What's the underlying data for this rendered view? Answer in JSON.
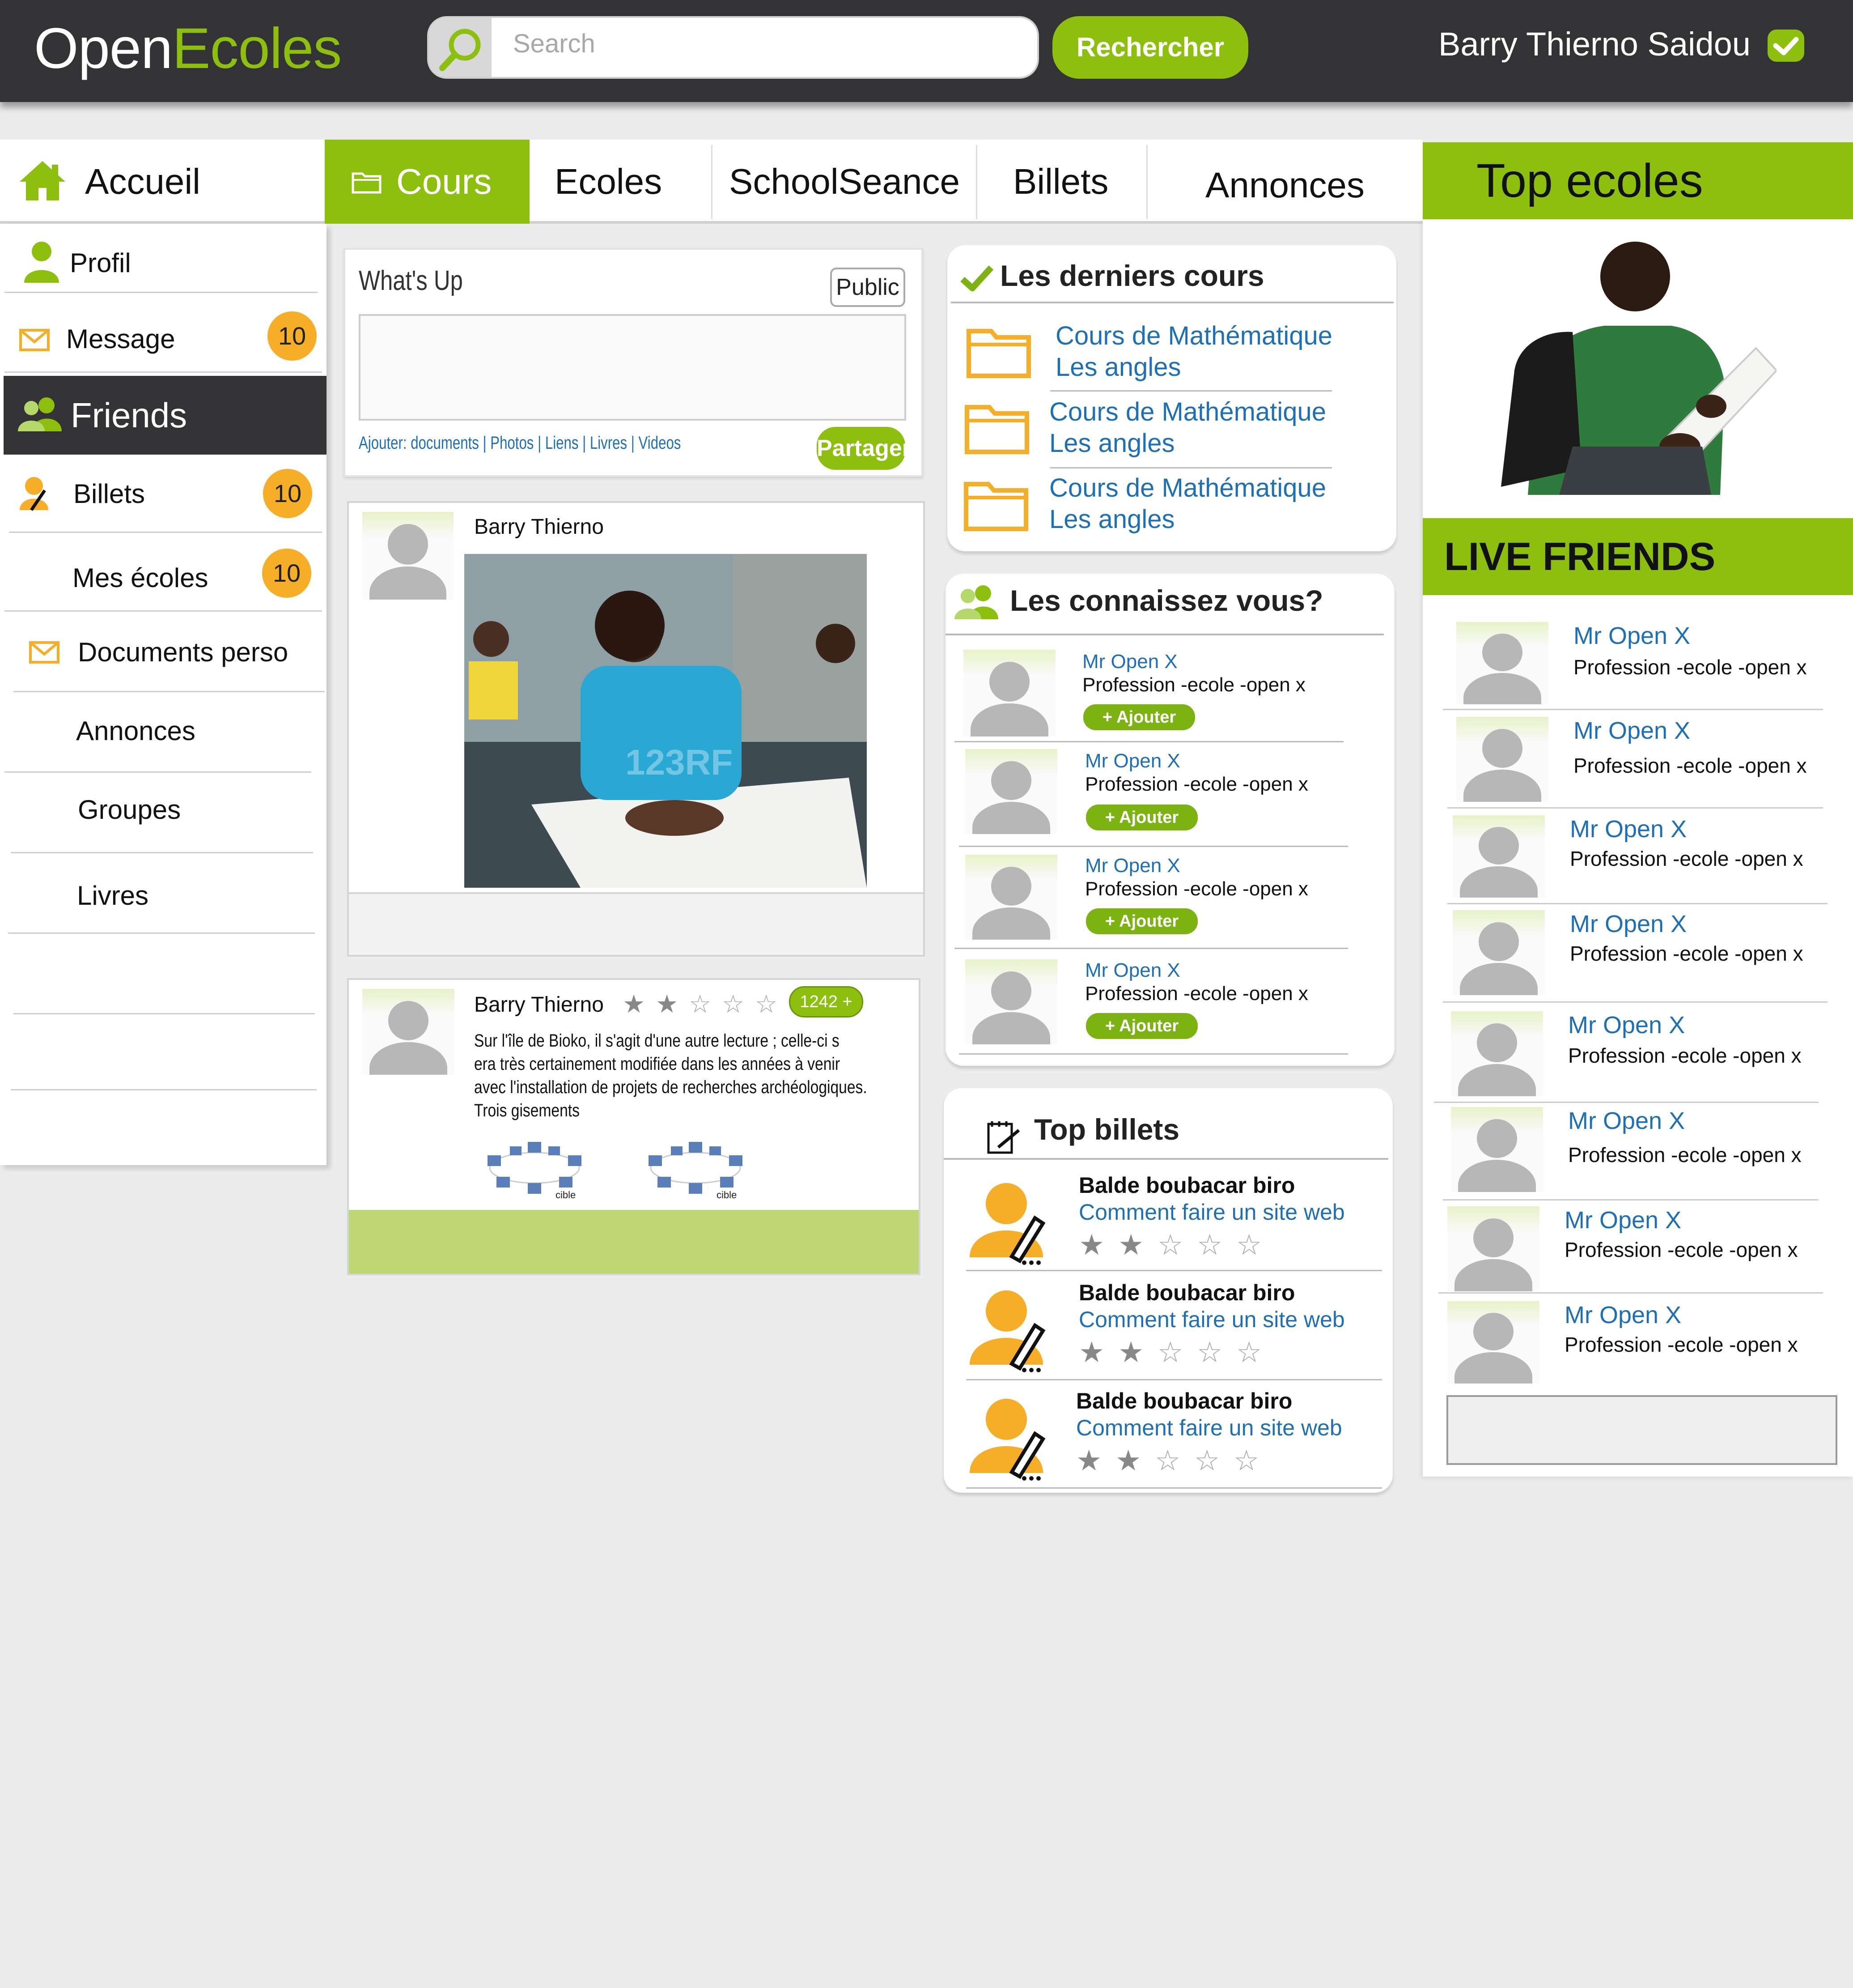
{
  "header": {
    "logo_open": "Open",
    "logo_ecoles": "Ecoles",
    "search_placeholder": "Search",
    "search_button": "Rechercher",
    "username": "Barry Thierno Saidou"
  },
  "nav": {
    "home": "Accueil",
    "cours": "Cours",
    "ecoles": "Ecoles",
    "schoolseance": "SchoolSeance",
    "billets": "Billets",
    "annonces": "Annonces"
  },
  "sidebar": {
    "items": [
      {
        "label": "Profil"
      },
      {
        "label": "Message",
        "badge": "10"
      },
      {
        "label": "Friends"
      },
      {
        "label": "Billets",
        "badge": "10"
      },
      {
        "label": "Mes écoles",
        "badge": "10"
      },
      {
        "label": "Documents perso"
      },
      {
        "label": "Annonces"
      },
      {
        "label": "Groupes"
      },
      {
        "label": "Livres"
      }
    ]
  },
  "whatsup": {
    "title": "What's Up",
    "visibility": "Public",
    "attach_prefix": "Ajouter: ",
    "attach_links": [
      "documents",
      "Photos",
      "Liens",
      "Livres",
      "Videos"
    ],
    "share_button": "Partager"
  },
  "posts": [
    {
      "author": "Barry Thierno",
      "photo_watermark": "123RF"
    },
    {
      "author": "Barry Thierno",
      "rating": 2,
      "count": "1242 +",
      "text_lines": [
        "Sur l'île de Bioko, il s'agit d'une autre lecture ; celle-ci s",
        "era très certainement modifiée dans les années à venir",
        "avec l'installation de projets de recherches archéologiques.",
        "Trois gisements"
      ],
      "thumb_caption": "cible"
    }
  ],
  "derniers_cours": {
    "title": "Les derniers cours",
    "items": [
      {
        "line1": "Cours de Mathématique",
        "line2": "Les angles"
      },
      {
        "line1": "Cours de Mathématique",
        "line2": "Les angles"
      },
      {
        "line1": "Cours de Mathématique",
        "line2": "Les angles"
      }
    ]
  },
  "connaissez": {
    "title": "Les connaissez vous?",
    "add_label": "+ Ajouter",
    "people": [
      {
        "name": "Mr Open X",
        "profession": "Profession -ecole -open x"
      },
      {
        "name": "Mr Open X",
        "profession": "Profession -ecole -open x"
      },
      {
        "name": "Mr Open X",
        "profession": "Profession -ecole -open x"
      },
      {
        "name": "Mr Open X",
        "profession": "Profession -ecole -open x"
      }
    ]
  },
  "top_billets": {
    "title": "Top billets",
    "items": [
      {
        "author": "Balde boubacar biro",
        "title": "Comment faire un site web",
        "rating": 2
      },
      {
        "author": "Balde boubacar biro",
        "title": "Comment faire un site web",
        "rating": 2
      },
      {
        "author": "Balde boubacar biro",
        "title": "Comment faire un site web",
        "rating": 2
      }
    ]
  },
  "right": {
    "top_ecoles_title": "Top ecoles",
    "live_friends_title": "LIVE FRIENDS",
    "friends": [
      {
        "name": "Mr Open X",
        "profession": "Profession -ecole -open x"
      },
      {
        "name": "Mr Open X",
        "profession": "Profession -ecole -open x"
      },
      {
        "name": "Mr Open X",
        "profession": "Profession -ecole -open x"
      },
      {
        "name": "Mr Open X",
        "profession": "Profession -ecole -open x"
      },
      {
        "name": "Mr Open X",
        "profession": "Profession -ecole -open x"
      },
      {
        "name": "Mr Open X",
        "profession": "Profession -ecole -open x"
      },
      {
        "name": "Mr Open X",
        "profession": "Profession -ecole -open x"
      },
      {
        "name": "Mr Open X",
        "profession": "Profession -ecole -open x"
      }
    ]
  },
  "colors": {
    "accent": "#8dbf0f",
    "dark": "#333335",
    "badge": "#f6ad28",
    "link": "#1f6fb5"
  }
}
